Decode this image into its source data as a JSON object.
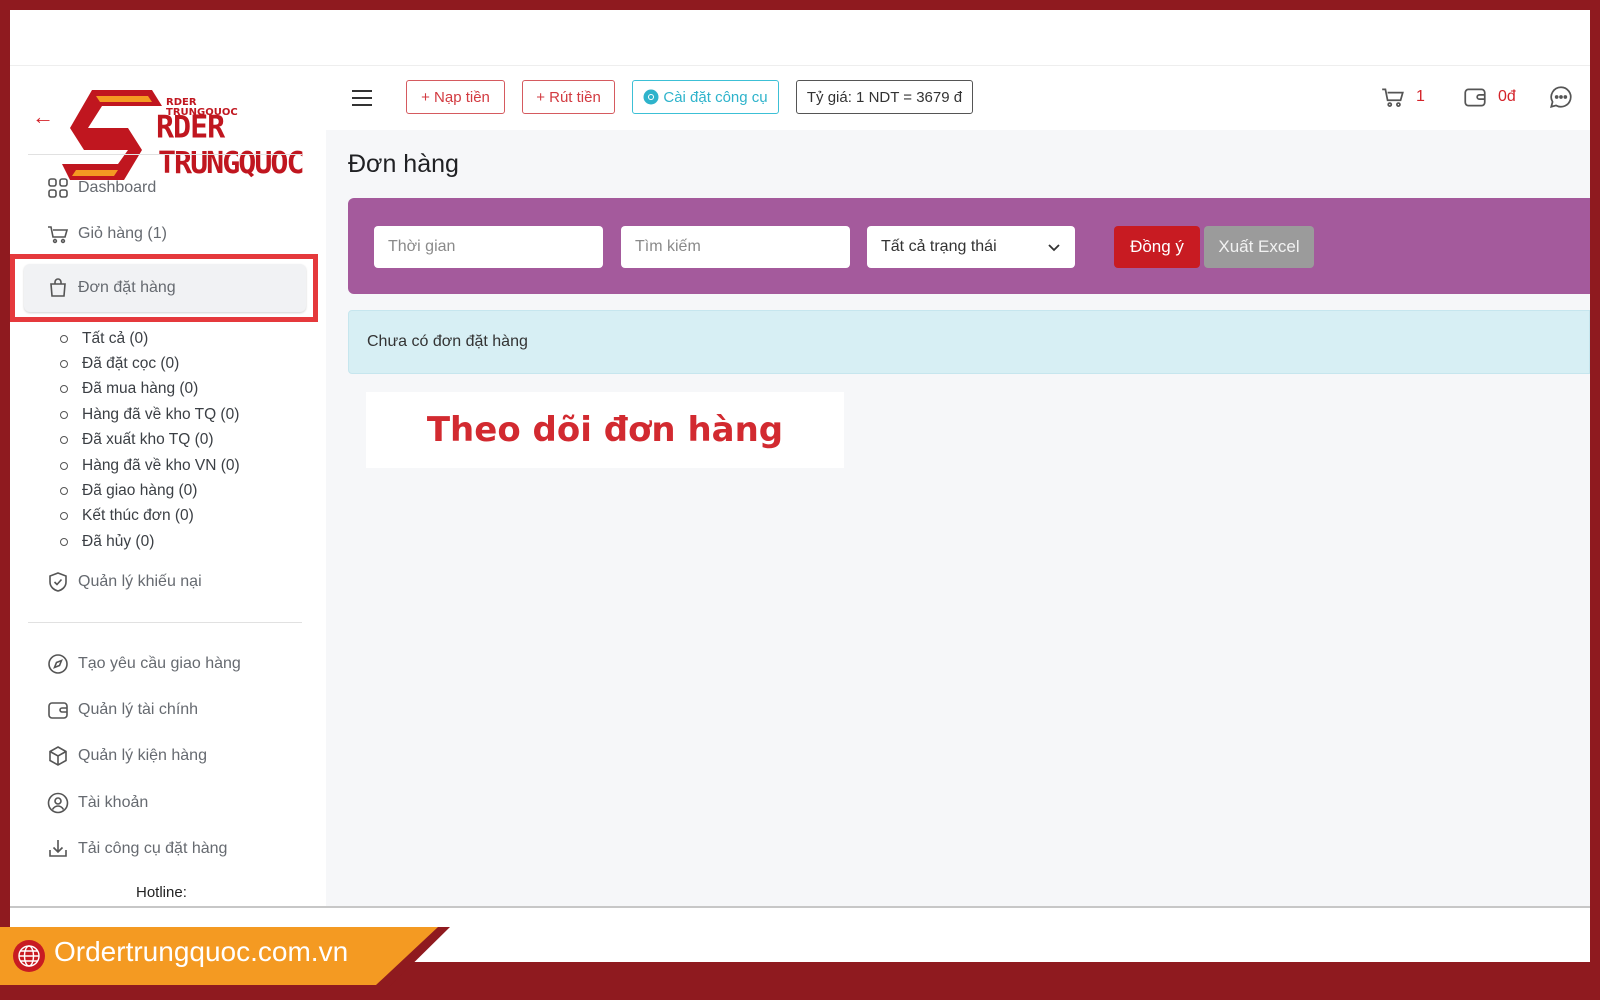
{
  "logo": {
    "small_text": "RDER\nTRUNGQUOC",
    "line1": "RDER",
    "line2": "TRUNGQUOC"
  },
  "topbar": {
    "deposit_label": "+ Nạp tiền",
    "withdraw_label": "+ Rút tiền",
    "install_tool_label": "Cài đặt công cụ",
    "exchange_rate": "Tỷ giá: 1 NDT = 3679 đ",
    "cart_count": "1",
    "wallet_balance": "0đ"
  },
  "sidebar": {
    "items": [
      {
        "label": "Dashboard",
        "icon": "grid-icon"
      },
      {
        "label": "Giỏ hàng (1)",
        "icon": "cart-icon"
      },
      {
        "label": "Đơn đặt hàng",
        "icon": "bag-icon"
      },
      {
        "label": "Quản lý khiếu nại",
        "icon": "shield-check-icon"
      },
      {
        "label": "Tạo yêu cầu giao hàng",
        "icon": "compass-icon"
      },
      {
        "label": "Quản lý tài chính",
        "icon": "wallet-icon"
      },
      {
        "label": "Quản lý kiện hàng",
        "icon": "box-icon"
      },
      {
        "label": "Tài khoản",
        "icon": "user-circle-icon"
      },
      {
        "label": "Tải công cụ đặt hàng",
        "icon": "download-icon"
      }
    ],
    "order_subitems": [
      "Tất cả (0)",
      "Đã đặt cọc (0)",
      "Đã mua hàng (0)",
      "Hàng đã về kho TQ (0)",
      "Đã xuất kho TQ (0)",
      "Hàng đã về kho VN (0)",
      "Đã giao hàng (0)",
      "Kết thúc đơn (0)",
      "Đã hủy (0)"
    ],
    "hotline_label": "Hotline:"
  },
  "main": {
    "title": "Đơn hàng",
    "filter": {
      "time_placeholder": "Thời gian",
      "search_placeholder": "Tìm kiếm",
      "status_selected": "Tất cả trạng thái",
      "submit_label": "Đồng ý",
      "export_label": "Xuất Excel"
    },
    "empty_notice": "Chưa có đơn đặt hàng",
    "caption": "Theo dõi đơn hàng"
  },
  "banner": {
    "url": "Ordertrungquoc.com.vn"
  },
  "colors": {
    "brand_red": "#c81b22",
    "frame": "#8f1a1f",
    "filter_bg": "#a45a9c",
    "banner_orange": "#f49a22"
  }
}
